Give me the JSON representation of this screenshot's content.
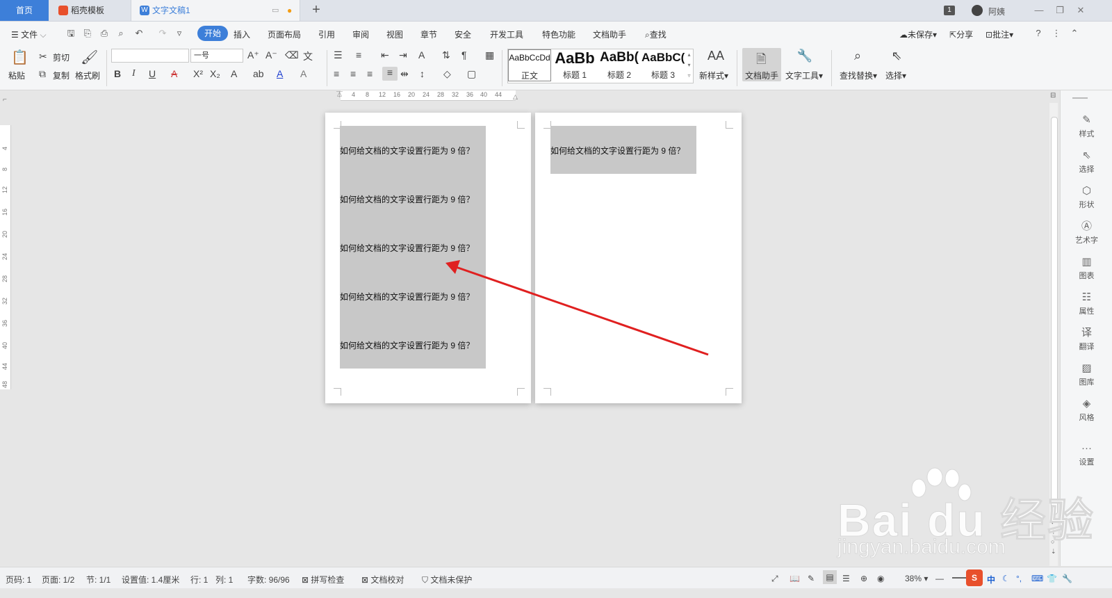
{
  "tabs": {
    "home": "首页",
    "template": "稻壳模板",
    "doc": "文字文稿1",
    "badge": "1",
    "user": "阿姨"
  },
  "menu": {
    "file": "文件",
    "start": "开始",
    "items": [
      "插入",
      "页面布局",
      "引用",
      "审阅",
      "视图",
      "章节",
      "安全",
      "开发工具",
      "特色功能",
      "文档助手"
    ],
    "find": "查找",
    "unsaved": "未保存",
    "share": "分享",
    "comment": "批注"
  },
  "ribbon": {
    "paste": "粘贴",
    "cut": "剪切",
    "copy": "复制",
    "format_painter": "格式刷",
    "font_name": "",
    "font_size": "一号",
    "styles": [
      {
        "preview": "AaBbCcDd",
        "name": "正文"
      },
      {
        "preview": "AaBb",
        "name": "标题 1"
      },
      {
        "preview": "AaBb(",
        "name": "标题 2"
      },
      {
        "preview": "AaBbC(",
        "name": "标题 3"
      }
    ],
    "new_style": "新样式",
    "doc_assistant": "文档助手",
    "text_tools": "文字工具",
    "find_replace": "查找替换",
    "select": "选择"
  },
  "ruler": {
    "h_ticks": [
      "4",
      "8",
      "12",
      "16",
      "20",
      "24",
      "28",
      "32",
      "36",
      "40",
      "44"
    ],
    "v_ticks": [
      "4",
      "8",
      "12",
      "16",
      "20",
      "24",
      "28",
      "32",
      "36",
      "40",
      "44",
      "48"
    ]
  },
  "document": {
    "page1_lines": [
      "如何给文档的文字设置行距为 9 倍？",
      "如何给文档的文字设置行距为 9 倍？",
      "如何给文档的文字设置行距为 9 倍？",
      "如何给文档的文字设置行距为 9 倍？",
      "如何给文档的文字设置行距为 9 倍？"
    ],
    "page2_lines": [
      "如何给文档的文字设置行距为 9 倍？"
    ]
  },
  "annotation": {
    "arrow_color": "#e02020"
  },
  "sidebar": {
    "items": [
      "样式",
      "选择",
      "形状",
      "艺术字",
      "图表",
      "属性",
      "翻译",
      "图库",
      "风格",
      "设置"
    ]
  },
  "status": {
    "page_no": "页码: 1",
    "pages": "页面: 1/2",
    "section": "节: 1/1",
    "setting": "设置值: 1.4厘米",
    "row": "行: 1",
    "col": "列: 1",
    "words": "字数: 96/96",
    "spell": "拼写检查",
    "proof": "文档校对",
    "protect": "文档未保护",
    "zoom": "38%"
  },
  "watermark": {
    "brand": "Bai du 经验",
    "url": "jingyan.baidu.com"
  },
  "colors": {
    "accent": "#3d7fd9",
    "shade": "#c8c8c8"
  }
}
